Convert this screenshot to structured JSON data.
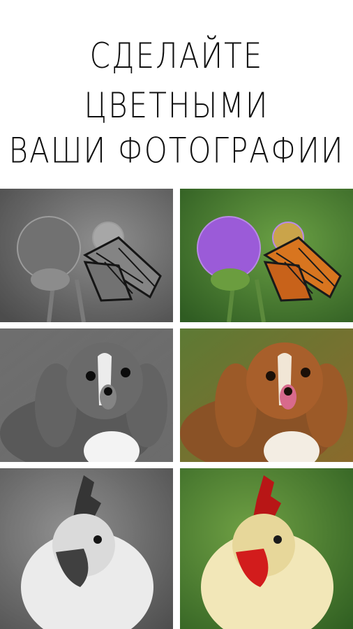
{
  "headline": {
    "line1": "СДЕЛАЙТЕ ЦВЕТНЫМИ",
    "line2": "ВАШИ ФОТОГРАФИИ"
  },
  "rows": [
    {
      "subject": "butterfly-on-thistle",
      "before": "grayscale",
      "after": "color"
    },
    {
      "subject": "spaniel-dog",
      "before": "grayscale",
      "after": "color"
    },
    {
      "subject": "rooster",
      "before": "grayscale",
      "after": "color"
    }
  ],
  "colors": {
    "background": "#ffffff",
    "thistle": "#9b5bd8",
    "butterfly": "#d8751f",
    "greenery": "#4e8a32",
    "dog_fur": "#a85f2b",
    "comb": "#d21c1c"
  }
}
